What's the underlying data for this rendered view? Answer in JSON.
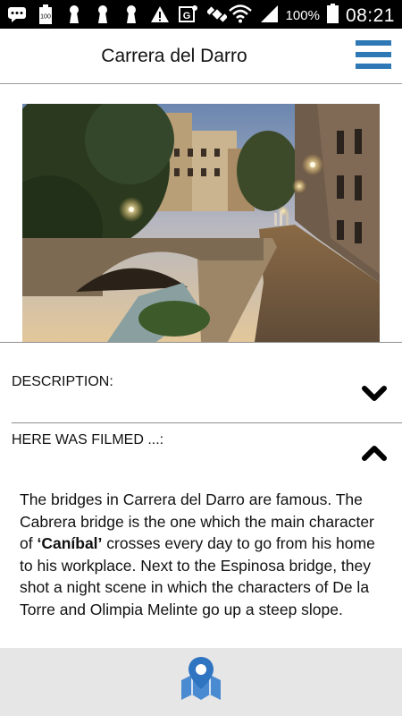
{
  "status_bar": {
    "battery_percent": "100%",
    "time": "08:21",
    "notification_badge": "100",
    "icons": [
      "chat-icon",
      "battery-saver-icon",
      "keyhole-icon",
      "keyhole-icon",
      "keyhole-icon",
      "warning-icon",
      "g-sync-icon",
      "satellite-icon",
      "wifi-icon",
      "signal-icon",
      "battery-icon"
    ]
  },
  "header": {
    "title": "Carrera del Darro",
    "menu_icon": "hamburger-menu-icon",
    "accent_color": "#2e79b5"
  },
  "photo": {
    "subject": "photo"
  },
  "sections": [
    {
      "label": "DESCRIPTION:",
      "state": "collapsed",
      "icon": "chevron-down-icon"
    },
    {
      "label": "HERE WAS FILMED ...:",
      "state": "expanded",
      "icon": "chevron-up-icon"
    }
  ],
  "filmed_text": {
    "part1": "The bridges in Carrera del Darro are famous. The Cabrera bridge is the one which the main character of ",
    "film": "‘Caníbal’",
    "part2": " crosses every day to go from his home to his workplace. Next to the Espinosa bridge, they shot a night scene in which the characters of De la Torre and Olimpia Melinte go up a steep slope."
  },
  "bottom_bar": {
    "map_icon": "map-pin-icon"
  }
}
